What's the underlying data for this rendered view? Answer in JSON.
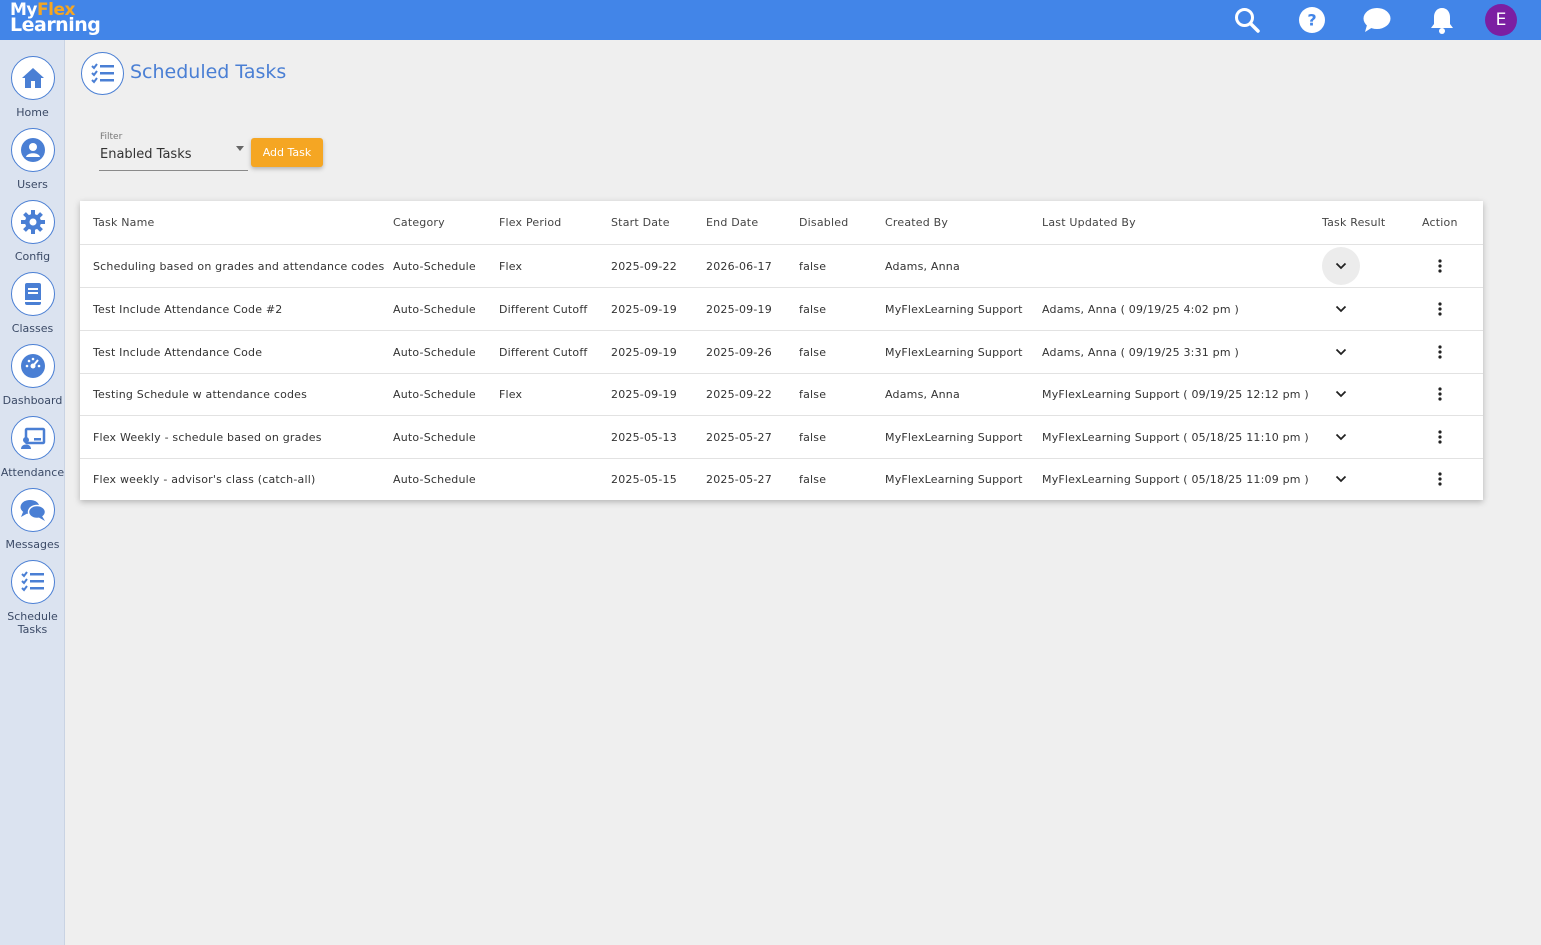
{
  "header": {
    "logo_line1_a": "My",
    "logo_line1_b": "Flex",
    "logo_line2": "Learning",
    "avatar_initial": "E",
    "icons": [
      "search-icon",
      "help-icon",
      "chat-icon",
      "bell-icon"
    ]
  },
  "sidebar": {
    "items": [
      {
        "label": "Home",
        "icon": "home-icon"
      },
      {
        "label": "Users",
        "icon": "user-icon"
      },
      {
        "label": "Config",
        "icon": "gear-icon"
      },
      {
        "label": "Classes",
        "icon": "book-icon"
      },
      {
        "label": "Dashboard",
        "icon": "gauge-icon"
      },
      {
        "label": "Attendance",
        "icon": "presentation-icon"
      },
      {
        "label": "Messages",
        "icon": "messages-icon"
      },
      {
        "label": "Schedule\nTasks",
        "icon": "checklist-icon"
      }
    ]
  },
  "page": {
    "title": "Scheduled Tasks",
    "filter_label": "Filter",
    "filter_value": "Enabled Tasks",
    "add_button": "Add Task"
  },
  "table": {
    "columns": [
      "Task Name",
      "Category",
      "Flex Period",
      "Start Date",
      "End Date",
      "Disabled",
      "Created By",
      "Last Updated By",
      "Task Result",
      "Action"
    ],
    "rows": [
      {
        "name": "Scheduling based on grades and attendance codes",
        "category": "Auto-Schedule",
        "period": "Flex",
        "start": "2025-09-22",
        "end": "2026-06-17",
        "disabled": "false",
        "created_by": "Adams, Anna",
        "updated_by": ""
      },
      {
        "name": "Test Include Attendance Code #2",
        "category": "Auto-Schedule",
        "period": "Different Cutoff",
        "start": "2025-09-19",
        "end": "2025-09-19",
        "disabled": "false",
        "created_by": "MyFlexLearning Support",
        "updated_by": "Adams, Anna ( 09/19/25 4:02 pm )"
      },
      {
        "name": "Test Include Attendance Code",
        "category": "Auto-Schedule",
        "period": "Different Cutoff",
        "start": "2025-09-19",
        "end": "2025-09-26",
        "disabled": "false",
        "created_by": "MyFlexLearning Support",
        "updated_by": "Adams, Anna ( 09/19/25 3:31 pm )"
      },
      {
        "name": "Testing Schedule w attendance codes",
        "category": "Auto-Schedule",
        "period": "Flex",
        "start": "2025-09-19",
        "end": "2025-09-22",
        "disabled": "false",
        "created_by": "Adams, Anna",
        "updated_by": "MyFlexLearning Support ( 09/19/25 12:12 pm )"
      },
      {
        "name": "Flex Weekly - schedule based on grades",
        "category": "Auto-Schedule",
        "period": "",
        "start": "2025-05-13",
        "end": "2025-05-27",
        "disabled": "false",
        "created_by": "MyFlexLearning Support",
        "updated_by": "MyFlexLearning Support ( 05/18/25 11:10 pm )"
      },
      {
        "name": "Flex weekly - advisor's class (catch-all)",
        "category": "Auto-Schedule",
        "period": "",
        "start": "2025-05-15",
        "end": "2025-05-27",
        "disabled": "false",
        "created_by": "MyFlexLearning Support",
        "updated_by": "MyFlexLearning Support ( 05/18/25 11:09 pm )"
      }
    ]
  },
  "colors": {
    "topbar": "#4285e8",
    "accent": "#4a7fd4",
    "button": "#f5a623",
    "avatar": "#7b1fa2"
  }
}
